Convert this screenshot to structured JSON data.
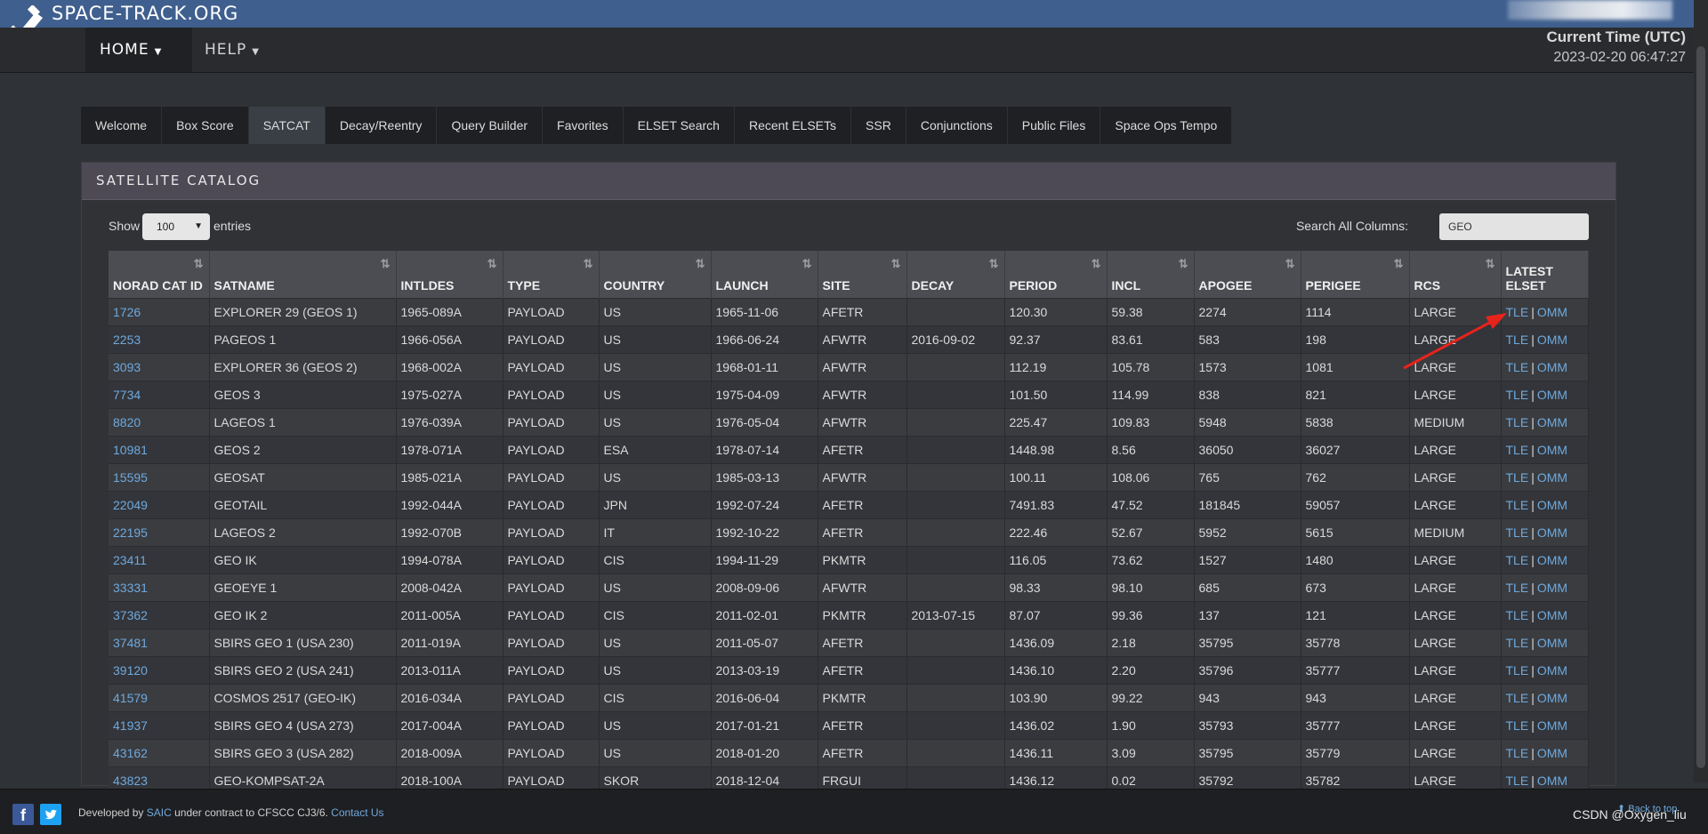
{
  "brand": "SPACE-TRACK.ORG",
  "nav": {
    "home": "HOME",
    "help": "HELP"
  },
  "time": {
    "label": "Current Time (UTC)",
    "value": "2023-02-20 06:47:27"
  },
  "tabs": [
    "Welcome",
    "Box Score",
    "SATCAT",
    "Decay/Reentry",
    "Query Builder",
    "Favorites",
    "ELSET Search",
    "Recent ELSETs",
    "SSR",
    "Conjunctions",
    "Public Files",
    "Space Ops Tempo"
  ],
  "active_tab": "SATCAT",
  "panel_title": "SATELLITE CATALOG",
  "show": {
    "label": "Show",
    "value": "100",
    "suffix": "entries"
  },
  "search": {
    "label": "Search All Columns:",
    "value": "GEO"
  },
  "columns": [
    "NORAD CAT ID",
    "SATNAME",
    "INTLDES",
    "TYPE",
    "COUNTRY",
    "LAUNCH",
    "SITE",
    "DECAY",
    "PERIOD",
    "INCL",
    "APOGEE",
    "PERIGEE",
    "RCS",
    "LATEST ELSET"
  ],
  "elset_links": {
    "tle": "TLE",
    "sep": "|",
    "omm": "OMM"
  },
  "rows": [
    [
      "1726",
      "EXPLORER 29 (GEOS 1)",
      "1965-089A",
      "PAYLOAD",
      "US",
      "1965-11-06",
      "AFETR",
      "",
      "120.30",
      "59.38",
      "2274",
      "1114",
      "LARGE"
    ],
    [
      "2253",
      "PAGEOS 1",
      "1966-056A",
      "PAYLOAD",
      "US",
      "1966-06-24",
      "AFWTR",
      "2016-09-02",
      "92.37",
      "83.61",
      "583",
      "198",
      "LARGE"
    ],
    [
      "3093",
      "EXPLORER 36 (GEOS 2)",
      "1968-002A",
      "PAYLOAD",
      "US",
      "1968-01-11",
      "AFWTR",
      "",
      "112.19",
      "105.78",
      "1573",
      "1081",
      "LARGE"
    ],
    [
      "7734",
      "GEOS 3",
      "1975-027A",
      "PAYLOAD",
      "US",
      "1975-04-09",
      "AFWTR",
      "",
      "101.50",
      "114.99",
      "838",
      "821",
      "LARGE"
    ],
    [
      "8820",
      "LAGEOS 1",
      "1976-039A",
      "PAYLOAD",
      "US",
      "1976-05-04",
      "AFWTR",
      "",
      "225.47",
      "109.83",
      "5948",
      "5838",
      "MEDIUM"
    ],
    [
      "10981",
      "GEOS 2",
      "1978-071A",
      "PAYLOAD",
      "ESA",
      "1978-07-14",
      "AFETR",
      "",
      "1448.98",
      "8.56",
      "36050",
      "36027",
      "LARGE"
    ],
    [
      "15595",
      "GEOSAT",
      "1985-021A",
      "PAYLOAD",
      "US",
      "1985-03-13",
      "AFWTR",
      "",
      "100.11",
      "108.06",
      "765",
      "762",
      "LARGE"
    ],
    [
      "22049",
      "GEOTAIL",
      "1992-044A",
      "PAYLOAD",
      "JPN",
      "1992-07-24",
      "AFETR",
      "",
      "7491.83",
      "47.52",
      "181845",
      "59057",
      "LARGE"
    ],
    [
      "22195",
      "LAGEOS 2",
      "1992-070B",
      "PAYLOAD",
      "IT",
      "1992-10-22",
      "AFETR",
      "",
      "222.46",
      "52.67",
      "5952",
      "5615",
      "MEDIUM"
    ],
    [
      "23411",
      "GEO IK",
      "1994-078A",
      "PAYLOAD",
      "CIS",
      "1994-11-29",
      "PKMTR",
      "",
      "116.05",
      "73.62",
      "1527",
      "1480",
      "LARGE"
    ],
    [
      "33331",
      "GEOEYE 1",
      "2008-042A",
      "PAYLOAD",
      "US",
      "2008-09-06",
      "AFWTR",
      "",
      "98.33",
      "98.10",
      "685",
      "673",
      "LARGE"
    ],
    [
      "37362",
      "GEO IK 2",
      "2011-005A",
      "PAYLOAD",
      "CIS",
      "2011-02-01",
      "PKMTR",
      "2013-07-15",
      "87.07",
      "99.36",
      "137",
      "121",
      "LARGE"
    ],
    [
      "37481",
      "SBIRS GEO 1 (USA 230)",
      "2011-019A",
      "PAYLOAD",
      "US",
      "2011-05-07",
      "AFETR",
      "",
      "1436.09",
      "2.18",
      "35795",
      "35778",
      "LARGE"
    ],
    [
      "39120",
      "SBIRS GEO 2 (USA 241)",
      "2013-011A",
      "PAYLOAD",
      "US",
      "2013-03-19",
      "AFETR",
      "",
      "1436.10",
      "2.20",
      "35796",
      "35777",
      "LARGE"
    ],
    [
      "41579",
      "COSMOS 2517 (GEO-IK)",
      "2016-034A",
      "PAYLOAD",
      "CIS",
      "2016-06-04",
      "PKMTR",
      "",
      "103.90",
      "99.22",
      "943",
      "943",
      "LARGE"
    ],
    [
      "41937",
      "SBIRS GEO 4 (USA 273)",
      "2017-004A",
      "PAYLOAD",
      "US",
      "2017-01-21",
      "AFETR",
      "",
      "1436.02",
      "1.90",
      "35793",
      "35777",
      "LARGE"
    ],
    [
      "43162",
      "SBIRS GEO 3 (USA 282)",
      "2018-009A",
      "PAYLOAD",
      "US",
      "2018-01-20",
      "AFETR",
      "",
      "1436.11",
      "3.09",
      "35795",
      "35779",
      "LARGE"
    ],
    [
      "43823",
      "GEO-KOMPSAT-2A",
      "2018-100A",
      "PAYLOAD",
      "SKOR",
      "2018-12-04",
      "FRGUI",
      "",
      "1436.12",
      "0.02",
      "35792",
      "35782",
      "LARGE"
    ]
  ],
  "footer": {
    "prefix": "Developed by",
    "saic": "SAIC",
    "middle": "under contract to CFSCC CJ3/6.",
    "contact": "Contact Us",
    "back_to_top": "Back to top"
  },
  "watermark": "CSDN @Oxygen_liu",
  "icons": [
    "satellite-logo-icon",
    "facebook-icon",
    "twitter-icon",
    "sort-icon",
    "annotation-arrow-icon"
  ]
}
